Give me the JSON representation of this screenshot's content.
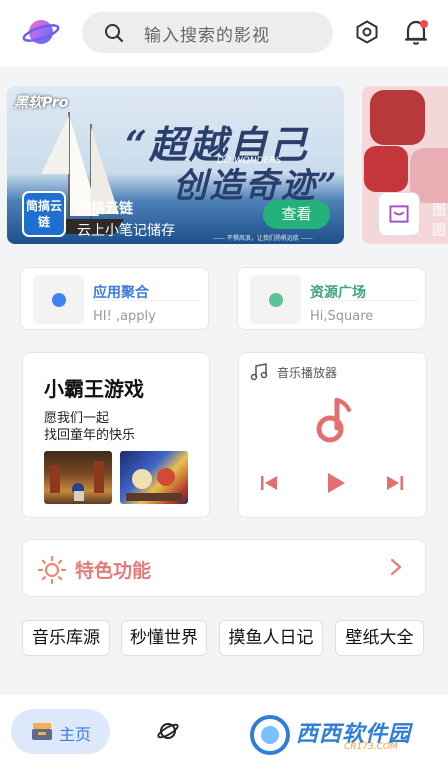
{
  "header": {
    "search_placeholder": "输入搜索的影视"
  },
  "banner": {
    "brand": "黑软Pro",
    "slogan_line1": "“超越自己",
    "slogan_line2": "创造奇迹”",
    "slogan_en": "DO WONDERS",
    "tagline": "—— 不惧风浪，让我们扬帆远航 ——",
    "app_icon_text": "简搞云链",
    "app_name": "简搞云链",
    "app_desc": "云上小笔记储存",
    "view_button": "查看"
  },
  "banner2": {
    "app_name": "图",
    "app_desc": "图"
  },
  "entries": [
    {
      "title": "应用聚合",
      "desc": "HI! ,apply",
      "title_color": "#3b7be0",
      "dot_color": "#3d86f2"
    },
    {
      "title": "资源广场",
      "desc": "Hi,Square",
      "title_color": "#3ea57a",
      "dot_color": "#5ec296"
    }
  ],
  "game_card": {
    "title": "小霸王游戏",
    "desc_line1": "愿我们一起",
    "desc_line2": "找回童年的快乐"
  },
  "music_card": {
    "label": "音乐播放器",
    "accent": "#e36f6f"
  },
  "feature": {
    "title": "特色功能"
  },
  "tags": [
    "音乐库源",
    "秒懂世界",
    "摸鱼人日记",
    "壁纸大全"
  ],
  "bottom_nav": {
    "home_label": "主页",
    "watermark_text": "西西软件园",
    "watermark_sub": "CR173.COM"
  }
}
